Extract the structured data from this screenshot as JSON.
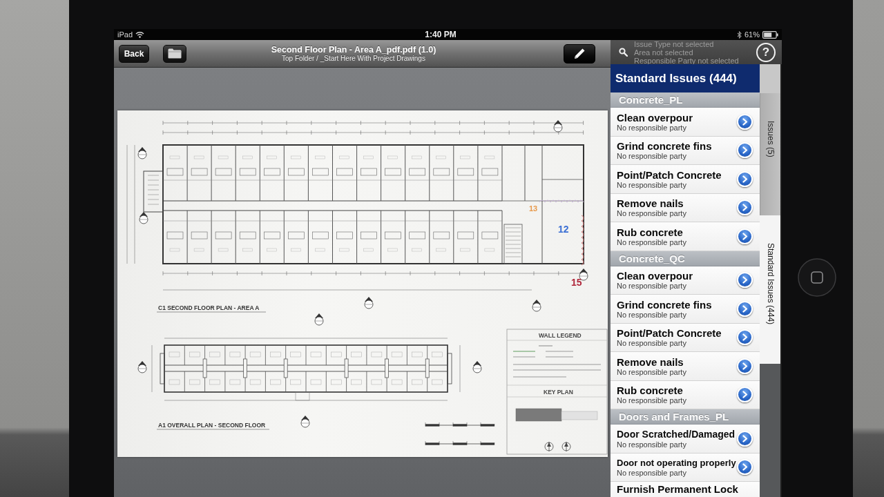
{
  "status_bar": {
    "device": "iPad",
    "time": "1:40 PM",
    "battery": "61%"
  },
  "toolbar": {
    "back": "Back",
    "title": "Second Floor Plan - Area A_pdf.pdf (1.0)",
    "path": "Top Folder / _Start Here With Project Drawings"
  },
  "document": {
    "plan_titles": [
      "C1 SECOND FLOOR PLAN - AREA A",
      "A1 OVERALL PLAN - SECOND FLOOR"
    ],
    "legend_title": "WALL LEGEND",
    "key_plan_title": "KEY PLAN",
    "markups": [
      {
        "label": "13",
        "color": "#e89a4c"
      },
      {
        "label": "12",
        "color": "#3b6fd4"
      },
      {
        "label": "15",
        "color": "#b0283c"
      }
    ]
  },
  "filter": {
    "lines": [
      "Issue Type not selected",
      "Area not selected",
      "Responsible Party not selected"
    ],
    "help": "?"
  },
  "panel": {
    "title": "Standard Issues (444)",
    "sections": [
      {
        "title": "Concrete_PL",
        "items": [
          {
            "title": "Clean overpour",
            "subtitle": "No responsible party"
          },
          {
            "title": "Grind concrete fins",
            "subtitle": "No responsible party"
          },
          {
            "title": "Point/Patch Concrete",
            "subtitle": "No responsible party"
          },
          {
            "title": "Remove nails",
            "subtitle": "No responsible party"
          },
          {
            "title": "Rub concrete",
            "subtitle": "No responsible party"
          }
        ]
      },
      {
        "title": "Concrete_QC",
        "items": [
          {
            "title": "Clean overpour",
            "subtitle": "No responsible party"
          },
          {
            "title": "Grind concrete fins",
            "subtitle": "No responsible party"
          },
          {
            "title": "Point/Patch Concrete",
            "subtitle": "No responsible party"
          },
          {
            "title": "Remove nails",
            "subtitle": "No responsible party"
          },
          {
            "title": "Rub concrete",
            "subtitle": "No responsible party"
          }
        ]
      },
      {
        "title": "Doors and Frames_PL",
        "items": [
          {
            "title": "Door Scratched/Damaged",
            "subtitle": "No responsible party"
          },
          {
            "title": "Door not operating properly",
            "subtitle": "No responsible party"
          },
          {
            "title": "Furnish Permanent Lock"
          }
        ]
      }
    ]
  },
  "side_tabs": [
    {
      "label": "Issues (5)",
      "selected": false
    },
    {
      "label": "Standard Issues (444)",
      "selected": true
    }
  ]
}
